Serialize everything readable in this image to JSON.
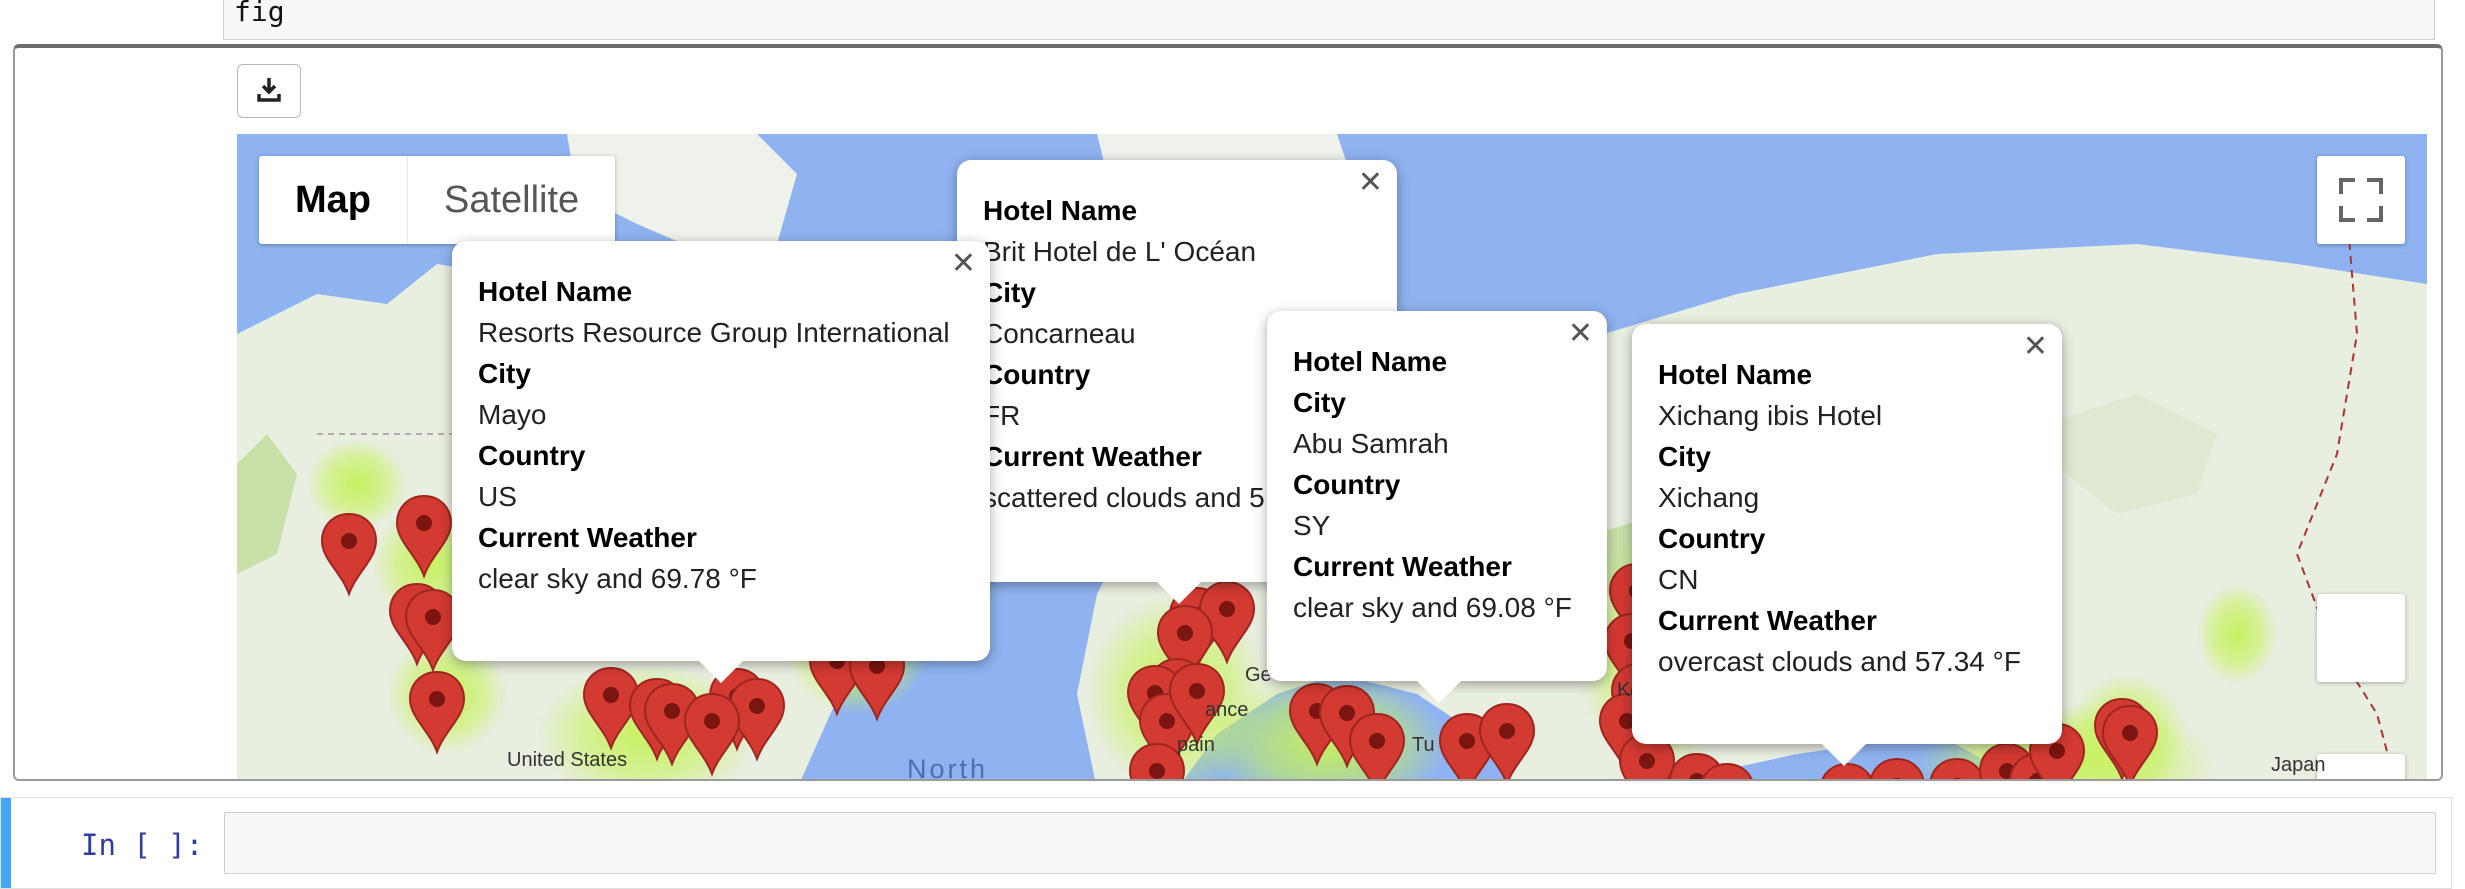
{
  "code_cell": {
    "text": "fig"
  },
  "map": {
    "type_buttons": [
      "Map",
      "Satellite"
    ],
    "labels": {
      "us": "United States",
      "ocean": "North",
      "japan": "Japan",
      "france": "ance",
      "spain": "pain",
      "germany": "Ge",
      "turkey": "Tu",
      "kaz": "Kaz"
    },
    "info_windows": [
      {
        "hotel_label": "Hotel Name",
        "hotel": "Resorts Resource Group International",
        "city_label": "City",
        "city": "Mayo",
        "country_label": "Country",
        "country": "US",
        "weather_label": "Current Weather",
        "weather": "clear sky and 69.78 °F"
      },
      {
        "hotel_label": "Hotel Name",
        "hotel": "Brit Hotel de L' Océan",
        "city_label": "City",
        "city": "Concarneau",
        "country_label": "Country",
        "country": "FR",
        "weather_label": "Current Weather",
        "weather": "scattered clouds and 5"
      },
      {
        "hotel_label": "Hotel Name",
        "hotel": "",
        "city_label": "City",
        "city": "Abu Samrah",
        "country_label": "Country",
        "country": "SY",
        "weather_label": "Current Weather",
        "weather": "clear sky and 69.08 °F"
      },
      {
        "hotel_label": "Hotel Name",
        "hotel": "Xichang ibis Hotel",
        "city_label": "City",
        "city": "Xichang",
        "country_label": "Country",
        "country": "CN",
        "weather_label": "Current Weather",
        "weather": "overcast clouds and 57.34 °F"
      }
    ],
    "colors": {
      "water": "#8fb3f0",
      "land": "#e8eee0",
      "marker": "#d33a32",
      "heat": "#c6f25a"
    }
  },
  "input_cell": {
    "prompt": "In [ ]:"
  }
}
